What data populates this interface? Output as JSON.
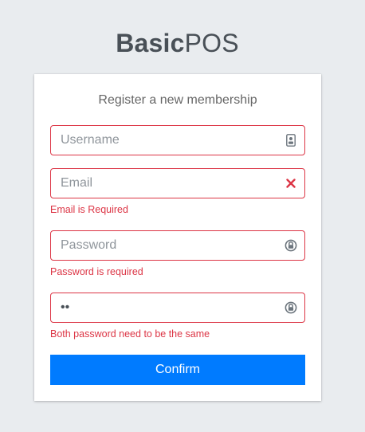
{
  "logo": {
    "bold": "Basic",
    "light": "POS"
  },
  "card": {
    "title": "Register a new membership"
  },
  "fields": {
    "username": {
      "placeholder": "Username",
      "value": "",
      "icon": "id-card-icon"
    },
    "email": {
      "placeholder": "Email",
      "value": "",
      "icon": "close-icon",
      "error": "Email is Required"
    },
    "password": {
      "placeholder": "Password",
      "value": "",
      "icon": "lock-icon",
      "error": "Password is required"
    },
    "confirm_password": {
      "placeholder": "",
      "value": "..",
      "icon": "lock-icon",
      "error": "Both password need to be the same"
    }
  },
  "submit": {
    "label": "Confirm"
  },
  "colors": {
    "error": "#dc3545",
    "primary": "#007bff",
    "background": "#e9ecef"
  }
}
